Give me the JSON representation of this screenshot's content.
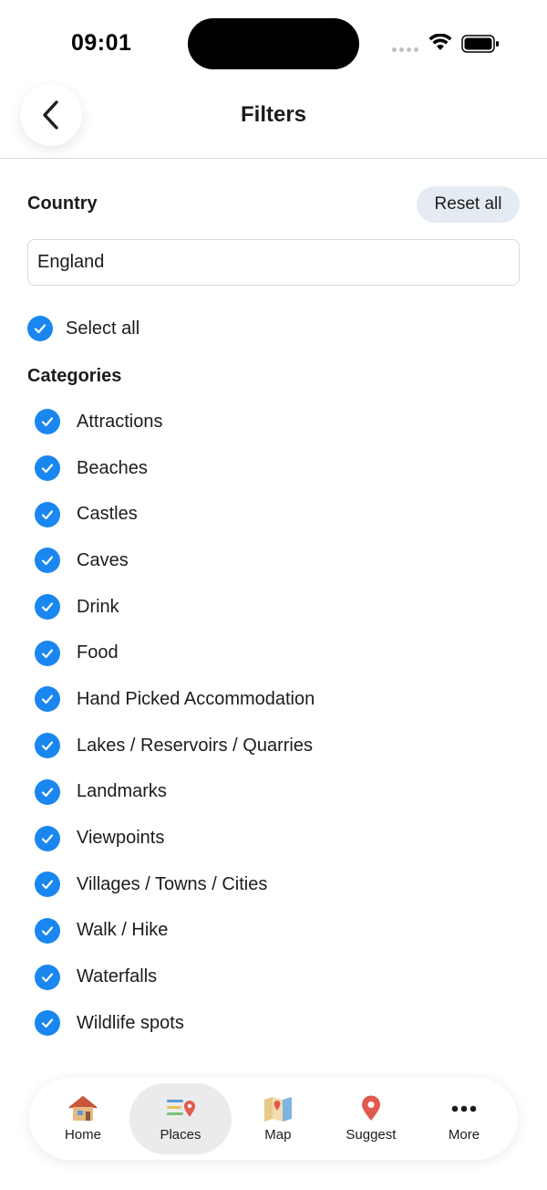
{
  "status": {
    "time": "09:01"
  },
  "header": {
    "title": "Filters",
    "back_icon": "chevron-left-icon"
  },
  "country": {
    "label": "Country",
    "reset_label": "Reset all",
    "value": "England"
  },
  "select_all": {
    "label": "Select all",
    "checked": true
  },
  "categories": {
    "label": "Categories",
    "items": [
      {
        "label": "Attractions",
        "checked": true
      },
      {
        "label": "Beaches",
        "checked": true
      },
      {
        "label": "Castles",
        "checked": true
      },
      {
        "label": "Caves",
        "checked": true
      },
      {
        "label": "Drink",
        "checked": true
      },
      {
        "label": "Food",
        "checked": true
      },
      {
        "label": "Hand Picked Accommodation",
        "checked": true
      },
      {
        "label": "Lakes / Reservoirs / Quarries",
        "checked": true
      },
      {
        "label": "Landmarks",
        "checked": true
      },
      {
        "label": "Viewpoints",
        "checked": true
      },
      {
        "label": "Villages / Towns / Cities",
        "checked": true
      },
      {
        "label": "Walk / Hike",
        "checked": true
      },
      {
        "label": "Waterfalls",
        "checked": true
      },
      {
        "label": "Wildlife spots",
        "checked": true
      }
    ]
  },
  "tabs": [
    {
      "label": "Home",
      "icon": "house-icon",
      "active": false
    },
    {
      "label": "Places",
      "icon": "list-pin-icon",
      "active": true
    },
    {
      "label": "Map",
      "icon": "map-icon",
      "active": false
    },
    {
      "label": "Suggest",
      "icon": "location-pin-icon",
      "active": false
    },
    {
      "label": "More",
      "icon": "more-dots-icon",
      "active": false
    }
  ],
  "colors": {
    "accent": "#1a86f0",
    "reset_bg": "#e5ebf2",
    "active_tab_bg": "#ebebed"
  }
}
